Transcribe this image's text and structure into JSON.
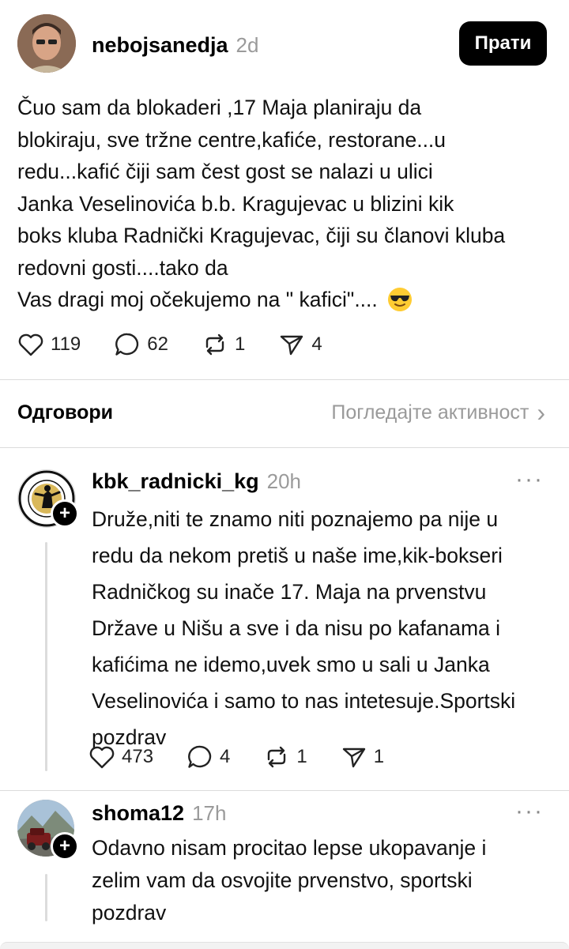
{
  "post": {
    "username": "nebojsanedja",
    "time": "2d",
    "follow_label": "Прати",
    "lines": [
      "Čuo sam da blokaderi ,17 Maja planiraju da",
      "blokiraju, sve tržne centre,kafiće, restorane...u",
      "redu...kafić čiji sam čest gost  se nalazi u ulici",
      "Janka Veselinovića b.b.  Kragujevac u blizini kik",
      "boks kluba Radnički Kragujevac, čiji su članovi kluba",
      "redovni gosti....tako da",
      "Vas dragi moj očekujemo na \" kafici\"...."
    ],
    "emoji": "😎",
    "stats": {
      "likes": "119",
      "comments": "62",
      "reposts": "1",
      "shares": "4"
    }
  },
  "replies_header": {
    "title": "Одговори",
    "activity_link": "Погледајте активност"
  },
  "replies": [
    {
      "username": "kbk_radnicki_kg",
      "time": "20h",
      "lines": [
        "Druže,niti te znamo niti poznajemo pa nije u",
        "redu da nekom pretiš u naše ime,kik-bokseri",
        "Radničkog su inače 17. Maja na prvenstvu",
        "Države u Nišu a sve i da nisu po kafanama i",
        "kafićima ne idemo,uvek smo u sali u Janka",
        "Veselinovića i samo to nas intetesuje.Sportski",
        "pozdrav"
      ],
      "stats": {
        "likes": "473",
        "comments": "4",
        "reposts": "1",
        "shares": "1"
      }
    },
    {
      "username": "shoma12",
      "time": "17h",
      "lines": [
        "Odavno nisam procitao lepse ukopavanje i",
        "zelim vam  da  osvojite prvenstvo, sportski",
        "pozdrav"
      ]
    }
  ],
  "icons": {
    "plus": "+",
    "more": "···",
    "chevron": "›"
  }
}
